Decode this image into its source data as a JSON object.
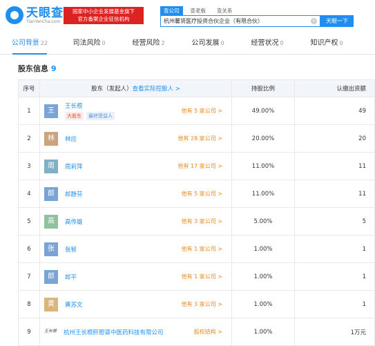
{
  "header": {
    "logo_cn": "天眼查",
    "logo_en": "TianYanCha.com",
    "badge_line1": "国家中小企业发展基金旗下",
    "badge_line2": "官方备案企业征信机构",
    "search_tabs": [
      "查公司",
      "查老板",
      "查关系"
    ],
    "search_value": "杭州馨贤医疗投资合伙企业（有限合伙）",
    "search_button": "天眼一下",
    "clear_icon": "×"
  },
  "nav": [
    {
      "label": "公司背景",
      "count": "22"
    },
    {
      "label": "司法风险",
      "count": "0"
    },
    {
      "label": "经营风险",
      "count": "2"
    },
    {
      "label": "公司发展",
      "count": "0"
    },
    {
      "label": "经营状况",
      "count": "0"
    },
    {
      "label": "知识产权",
      "count": "0"
    }
  ],
  "section": {
    "title": "股东信息",
    "count": "9"
  },
  "table": {
    "headers": {
      "idx": "序号",
      "holder": "股东（发起人）",
      "holder_link": "查看实际控股人 >",
      "ratio": "持股比例",
      "amount": "认缴出资额"
    },
    "rows": [
      {
        "idx": "1",
        "avatar": "王",
        "avatar_color": "#7aa3d6",
        "name": "王长根",
        "companies": "他有 5 家公司 >",
        "ratio": "49.00%",
        "amount": "49",
        "tag1": "大股东",
        "tag2": "最终受益人"
      },
      {
        "idx": "2",
        "avatar": "林",
        "avatar_color": "#c9a47e",
        "name": "林应",
        "companies": "他有 28 家公司 >",
        "ratio": "20.00%",
        "amount": "20"
      },
      {
        "idx": "3",
        "avatar": "周",
        "avatar_color": "#7fb0c4",
        "name": "周莉萍",
        "companies": "他有 17 家公司 >",
        "ratio": "11.00%",
        "amount": "11"
      },
      {
        "idx": "4",
        "avatar": "郎",
        "avatar_color": "#7aa3d6",
        "name": "郎静芬",
        "companies": "他有 5 家公司 >",
        "ratio": "11.00%",
        "amount": "11"
      },
      {
        "idx": "5",
        "avatar": "高",
        "avatar_color": "#8fc29e",
        "name": "高传雄",
        "companies": "他有 3 家公司 >",
        "ratio": "5.00%",
        "amount": "5"
      },
      {
        "idx": "6",
        "avatar": "张",
        "avatar_color": "#7aa3d6",
        "name": "张智",
        "companies": "他有 1 家公司 >",
        "ratio": "1.00%",
        "amount": "1"
      },
      {
        "idx": "7",
        "avatar": "郎",
        "avatar_color": "#7aa3d6",
        "name": "郎平",
        "companies": "他有 1 家公司 >",
        "ratio": "1.00%",
        "amount": "1"
      },
      {
        "idx": "8",
        "avatar": "黄",
        "avatar_color": "#d9b57a",
        "name": "黄苏文",
        "companies": "他有 3 家公司 >",
        "ratio": "1.00%",
        "amount": "1"
      },
      {
        "idx": "9",
        "logo_text": "王长根",
        "name": "杭州王长根肝胆肾中医药科技有限公司",
        "companies": "股权结构 >",
        "ratio": "1.00%",
        "amount": "1万元"
      }
    ]
  },
  "colors": {
    "accent": "#1e8ff0",
    "orange": "#e8881c",
    "red_badge": "#dd2222"
  }
}
